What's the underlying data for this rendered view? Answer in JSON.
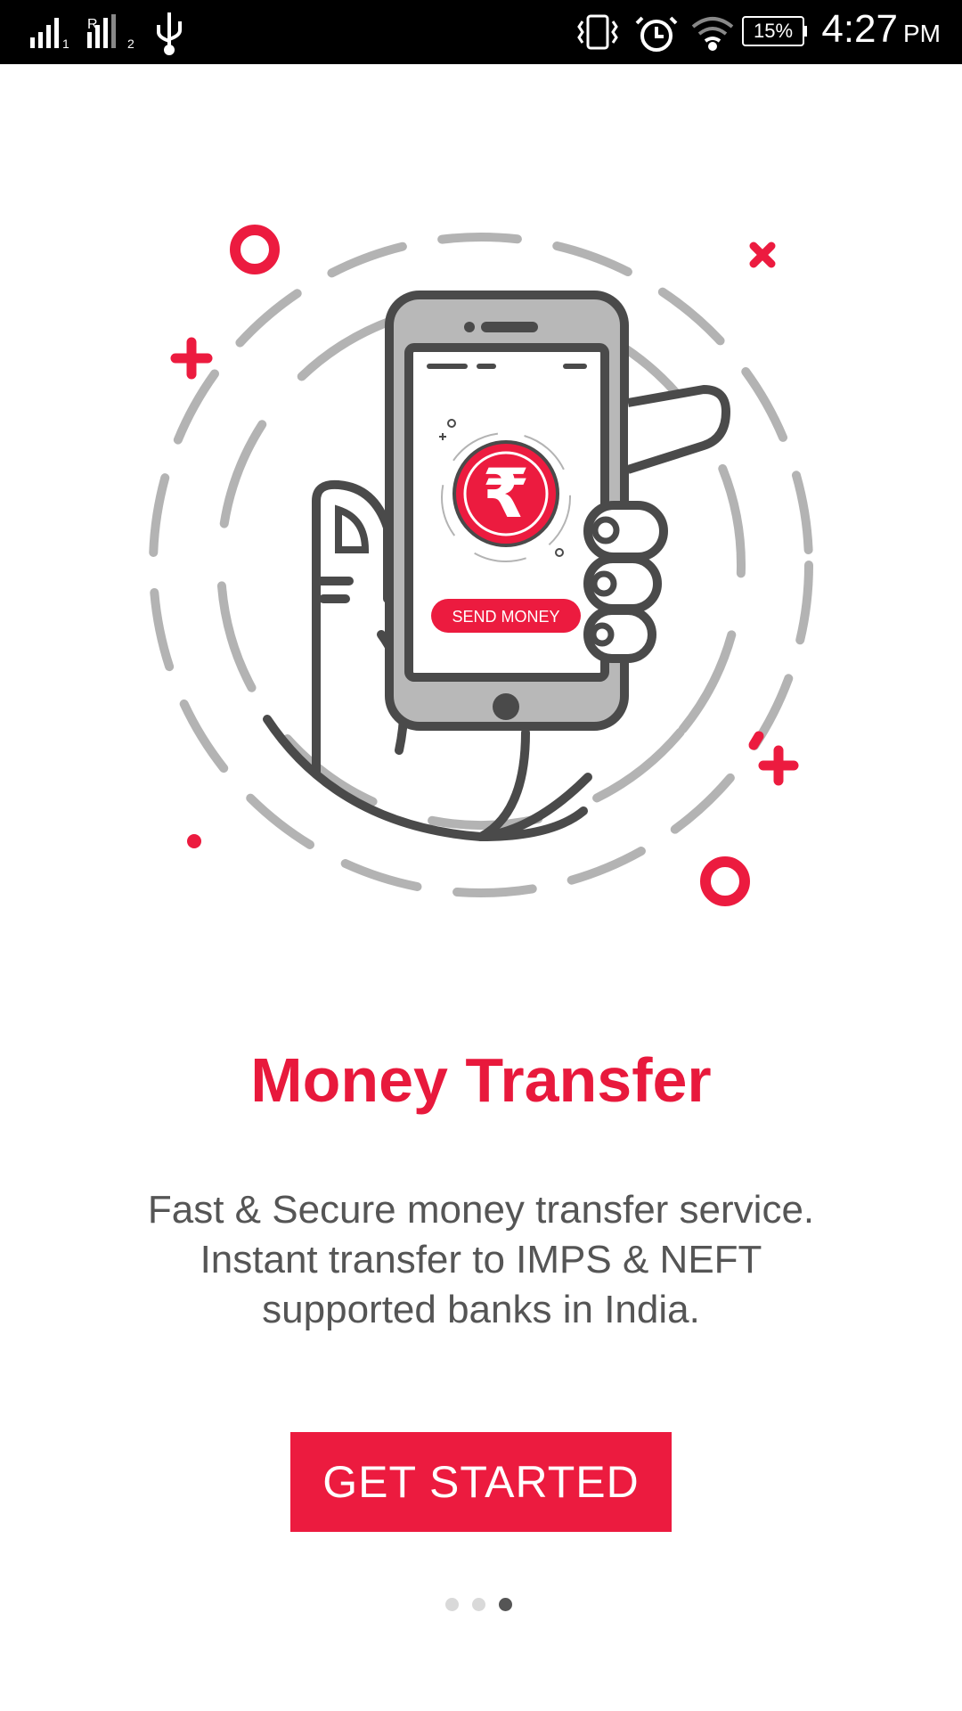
{
  "status_bar": {
    "battery_text": "15%",
    "time": "4:27",
    "ampm": "PM",
    "icons": [
      "signal-sim1-icon",
      "signal-sim2-icon",
      "usb-icon",
      "vibrate-icon",
      "alarm-icon",
      "wifi-icon",
      "battery-icon"
    ]
  },
  "illustration": {
    "send_money_label": "SEND MONEY",
    "currency_symbol": "₹"
  },
  "onboarding": {
    "title": "Money Transfer",
    "description_lines": [
      "Fast & Secure money transfer service.",
      "Instant transfer to IMPS & NEFT",
      "supported banks in India."
    ],
    "cta_label": "GET STARTED"
  },
  "pager": {
    "total_pages": 3,
    "current_page": 3
  },
  "colors": {
    "accent": "#ec1b3f",
    "text_gray": "#555555",
    "outline": "#4a4a4a",
    "dash_gray": "#b3b3b3",
    "dot_inactive": "#d9d9d9",
    "dot_active": "#555555"
  }
}
